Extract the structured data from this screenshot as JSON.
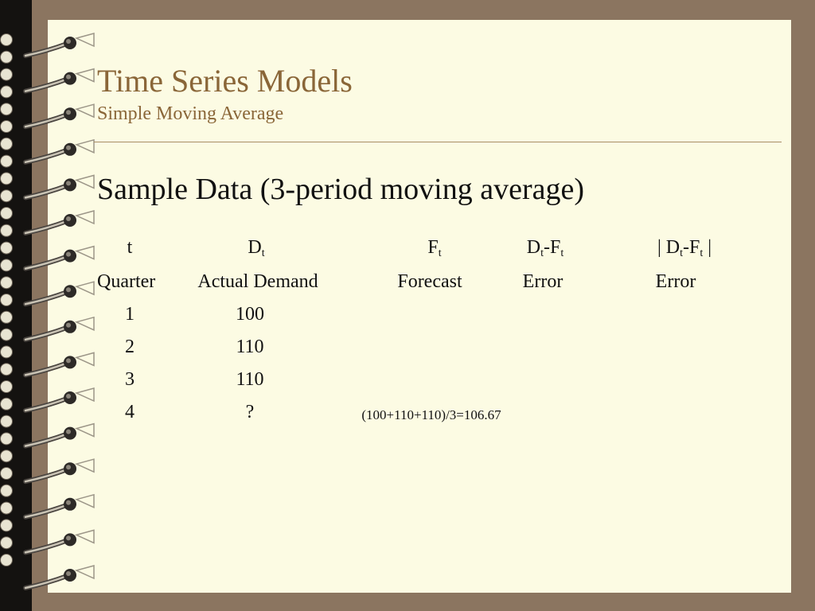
{
  "slide": {
    "title": "Time Series Models",
    "subtitle": "Simple Moving Average",
    "heading": "Sample Data  (3-period moving average)"
  },
  "table": {
    "symbols": {
      "t": "t",
      "D": "D",
      "F": "F",
      "sub_t": "t",
      "minus": "-",
      "bar": "|"
    },
    "headers": [
      "Quarter",
      "Actual Demand",
      "Forecast",
      "Error",
      "Error"
    ],
    "rows": [
      {
        "t": "1",
        "d": "100",
        "f": ""
      },
      {
        "t": "2",
        "d": "110",
        "f": ""
      },
      {
        "t": "3",
        "d": "110",
        "f": ""
      },
      {
        "t": "4",
        "d": "?",
        "f": "(100+110+110)/3=106.67"
      }
    ]
  },
  "colors": {
    "background": "#8b7560",
    "page": "#fcfbe3",
    "title": "#8a6638",
    "text": "#111111",
    "binding_strip": "#141210"
  }
}
